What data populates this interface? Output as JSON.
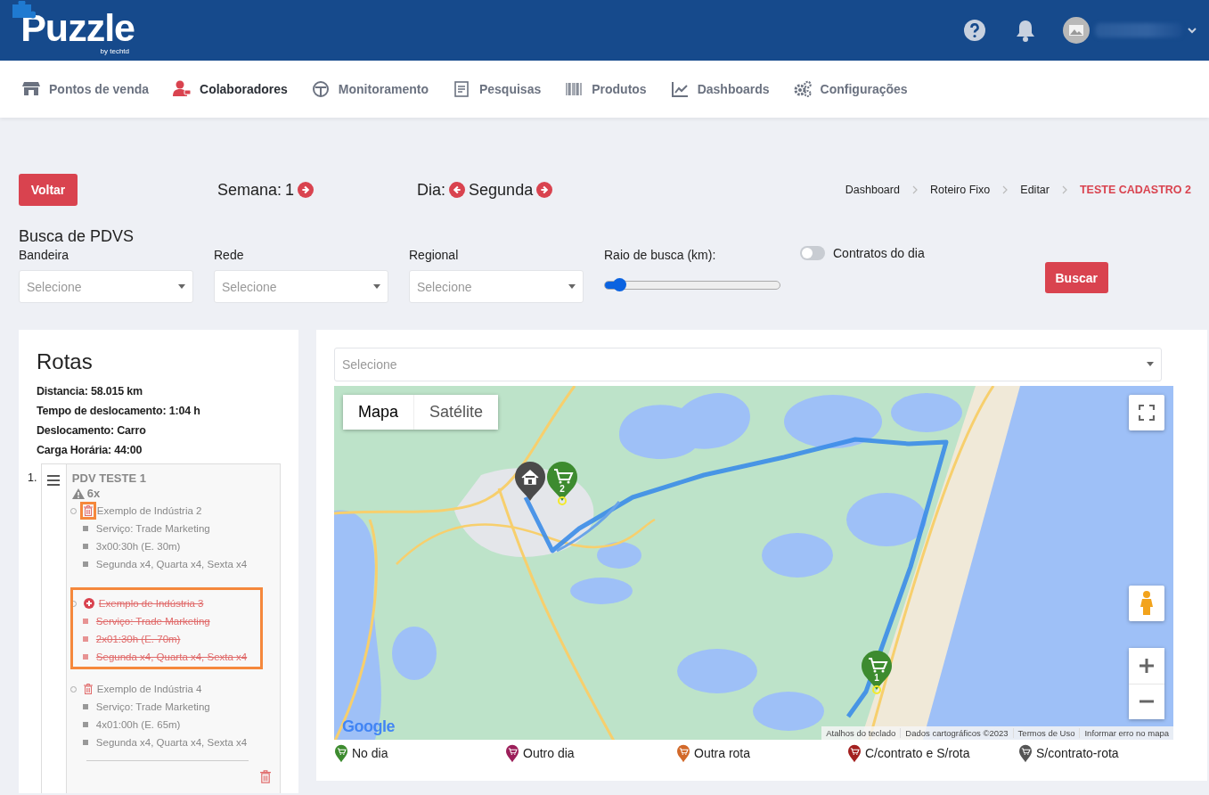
{
  "header": {
    "logo_title": "Puzzle",
    "logo_subtitle": "by techtd"
  },
  "nav": [
    {
      "label": "Pontos de venda",
      "selected": false
    },
    {
      "label": "Colaboradores",
      "selected": true
    },
    {
      "label": "Monitoramento",
      "selected": false
    },
    {
      "label": "Pesquisas",
      "selected": false
    },
    {
      "label": "Produtos",
      "selected": false
    },
    {
      "label": "Dashboards",
      "selected": false
    },
    {
      "label": "Configurações",
      "selected": false
    }
  ],
  "toolbar": {
    "back_button": "Voltar",
    "week_label": "Semana:",
    "week_value": "1",
    "day_label": "Dia:",
    "day_value": "Segunda",
    "breadcrumb": [
      {
        "label": "Dashboard",
        "current": false
      },
      {
        "label": "Roteiro Fixo",
        "current": false
      },
      {
        "label": "Editar",
        "current": false
      },
      {
        "label": "TESTE CADASTRO 2",
        "current": true
      }
    ]
  },
  "search": {
    "title": "Busca de PDVS",
    "filters": [
      {
        "label": "Bandeira",
        "placeholder": "Selecione"
      },
      {
        "label": "Rede",
        "placeholder": "Selecione"
      },
      {
        "label": "Regional",
        "placeholder": "Selecione"
      }
    ],
    "radius": {
      "label": "Raio de busca (km):",
      "level": 0.08
    },
    "toggle": {
      "label": "Contratos do dia",
      "on": false
    },
    "button": "Buscar"
  },
  "routes": {
    "title": "Rotas",
    "stats": [
      "Distancia: 58.015 km",
      "Tempo de deslocamento: 1:04 h",
      "Deslocamento: Carro",
      "Carga Horária: 44:00"
    ],
    "stops": [
      {
        "number": "1.",
        "name": "PDV TESTE 1",
        "count": "6x",
        "industries": [
          {
            "name": "Exemplo de Indústria 2",
            "removed": false,
            "icon_highlighted": true,
            "row_highlighted": false,
            "details": [
              "Serviço: Trade Marketing",
              "3x00:30h (E. 30m)",
              "Segunda x4, Quarta x4, Sexta x4"
            ]
          },
          {
            "name": "Exemplo de Indústria 3",
            "removed": true,
            "icon_highlighted": false,
            "row_highlighted": true,
            "details": [
              "Serviço: Trade Marketing",
              "2x01:30h (E. 70m)",
              "Segunda x4, Quarta x4, Sexta x4"
            ]
          },
          {
            "name": "Exemplo de Indústria 4",
            "removed": false,
            "icon_highlighted": false,
            "row_highlighted": false,
            "details": [
              "Serviço: Trade Marketing",
              "4x01:00h (E. 65m)",
              "Segunda x4, Quarta x4, Sexta x4"
            ]
          }
        ]
      }
    ]
  },
  "map": {
    "select_placeholder": "Selecione",
    "map_types": [
      {
        "label": "Mapa",
        "selected": true
      },
      {
        "label": "Satélite",
        "selected": false
      }
    ],
    "logo": "Google",
    "attribution": [
      "Atalhos do teclado",
      "Dados cartográficos ©2023",
      "Termos de Uso",
      "Informar erro no mapa"
    ],
    "markers": [
      {
        "kind": "home"
      },
      {
        "kind": "store",
        "number": "2"
      },
      {
        "kind": "store",
        "number": "1"
      }
    ],
    "legend": [
      {
        "label": "No dia",
        "color": "#3d8b2f"
      },
      {
        "label": "Outro dia",
        "color": "#9c1f5a"
      },
      {
        "label": "Outra rota",
        "color": "#d2692a"
      },
      {
        "label": "C/contrato e S/rota",
        "color": "#a3201f"
      },
      {
        "label": "S/contrato-rota",
        "color": "#555555"
      }
    ]
  }
}
